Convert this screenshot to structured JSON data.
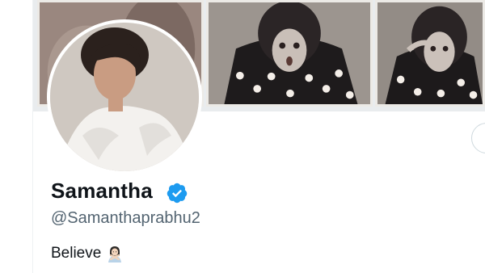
{
  "profile": {
    "display_name": "Samantha",
    "verified": true,
    "handle": "@Samanthaprabhu2",
    "bio_text": "Believe",
    "bio_emoji": "woman-gesturing-no-icon"
  },
  "header": {
    "photos": [
      "banner-photo-1",
      "banner-photo-2",
      "banner-photo-3"
    ]
  },
  "colors": {
    "verified_blue": "#1d9bf0",
    "name_text": "#0f1419",
    "handle_text": "#536471",
    "banner_bg": "#e9ecee"
  }
}
